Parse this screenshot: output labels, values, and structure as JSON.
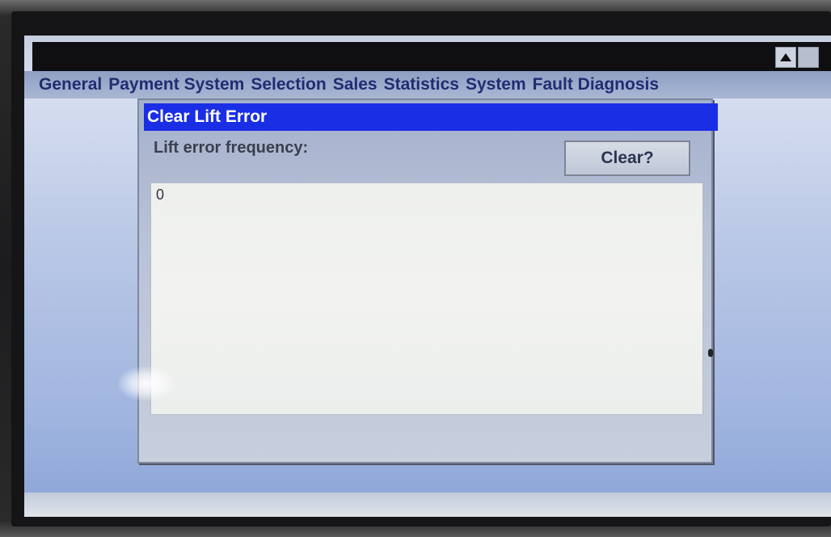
{
  "menu": {
    "items": [
      {
        "label": "General"
      },
      {
        "label": "Payment System"
      },
      {
        "label": "Selection"
      },
      {
        "label": "Sales"
      },
      {
        "label": "Statistics"
      },
      {
        "label": "System"
      },
      {
        "label": "Fault Diagnosis"
      }
    ]
  },
  "window_controls": {
    "up_icon": "triangle-up-icon",
    "box_icon": "square-icon"
  },
  "dialog": {
    "title": "Clear Lift Error",
    "field_label": "Lift error frequency:",
    "clear_button": "Clear?",
    "value": "0"
  },
  "colors": {
    "dialog_title_bg": "#1a2ee6",
    "menu_text": "#1f2d72"
  }
}
